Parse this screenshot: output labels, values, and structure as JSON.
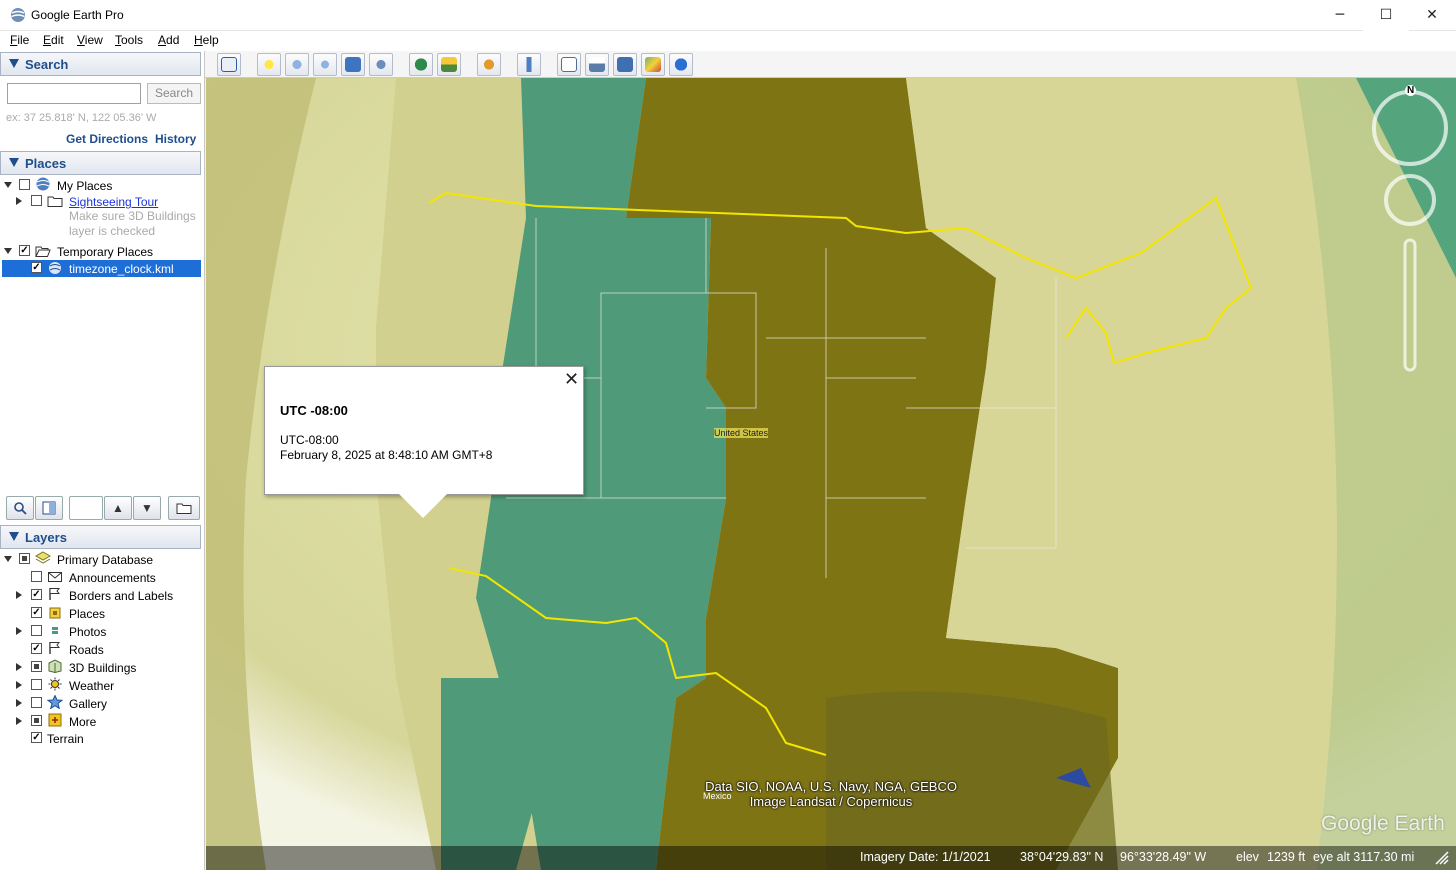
{
  "window": {
    "title": "Google Earth Pro",
    "minimize": "─",
    "maximize": "☐",
    "close": "✕"
  },
  "menu": [
    "File",
    "Edit",
    "View",
    "Tools",
    "Add",
    "Help"
  ],
  "search": {
    "header": "Search",
    "input_value": "",
    "button": "Search",
    "hint": "ex: 37 25.818' N, 122 05.36' W",
    "get_directions": "Get Directions",
    "history": "History"
  },
  "places": {
    "header": "Places",
    "items": [
      {
        "label": "My Places"
      },
      {
        "label": "Sightseeing Tour",
        "desc1": "Make sure 3D Buildings",
        "desc2": "layer is checked"
      },
      {
        "label": "Temporary Places"
      },
      {
        "label": "timezone_clock.kml"
      }
    ]
  },
  "layers": {
    "header": "Layers",
    "items": [
      {
        "label": "Primary Database"
      },
      {
        "label": "Announcements"
      },
      {
        "label": "Borders and Labels"
      },
      {
        "label": "Places"
      },
      {
        "label": "Photos"
      },
      {
        "label": "Roads"
      },
      {
        "label": "3D Buildings"
      },
      {
        "label": "Weather"
      },
      {
        "label": "Gallery"
      },
      {
        "label": "More"
      },
      {
        "label": "Terrain"
      }
    ]
  },
  "popup": {
    "title": "UTC -08:00",
    "line1": "UTC-08:00",
    "line2": "February 8, 2025 at 8:48:10 AM GMT+8",
    "close": "✕"
  },
  "map": {
    "country_label": "United States",
    "city_label": "Mexico",
    "compass_north": "N",
    "attribution_line1": "Data SIO, NOAA, U.S. Navy, NGA, GEBCO",
    "attribution_line2": "Image Landsat / Copernicus",
    "watermark": "Google Earth"
  },
  "status": {
    "imagery_date": "Imagery Date: 1/1/2021",
    "lat": "38°04'29.83\" N",
    "lon": "96°33'28.49\" W",
    "elev_label": "elev",
    "elev": "1239 ft",
    "eye_alt": "eye alt 3117.30 mi"
  },
  "colors": {
    "accent": "#1e4e8c",
    "selected": "#1e6ed8",
    "zone_green": "#4f9a78",
    "zone_olive": "#7f7414",
    "zone_pale": "#d8d697",
    "zone_light": "#c9c985",
    "border_yellow": "#f2e600"
  }
}
